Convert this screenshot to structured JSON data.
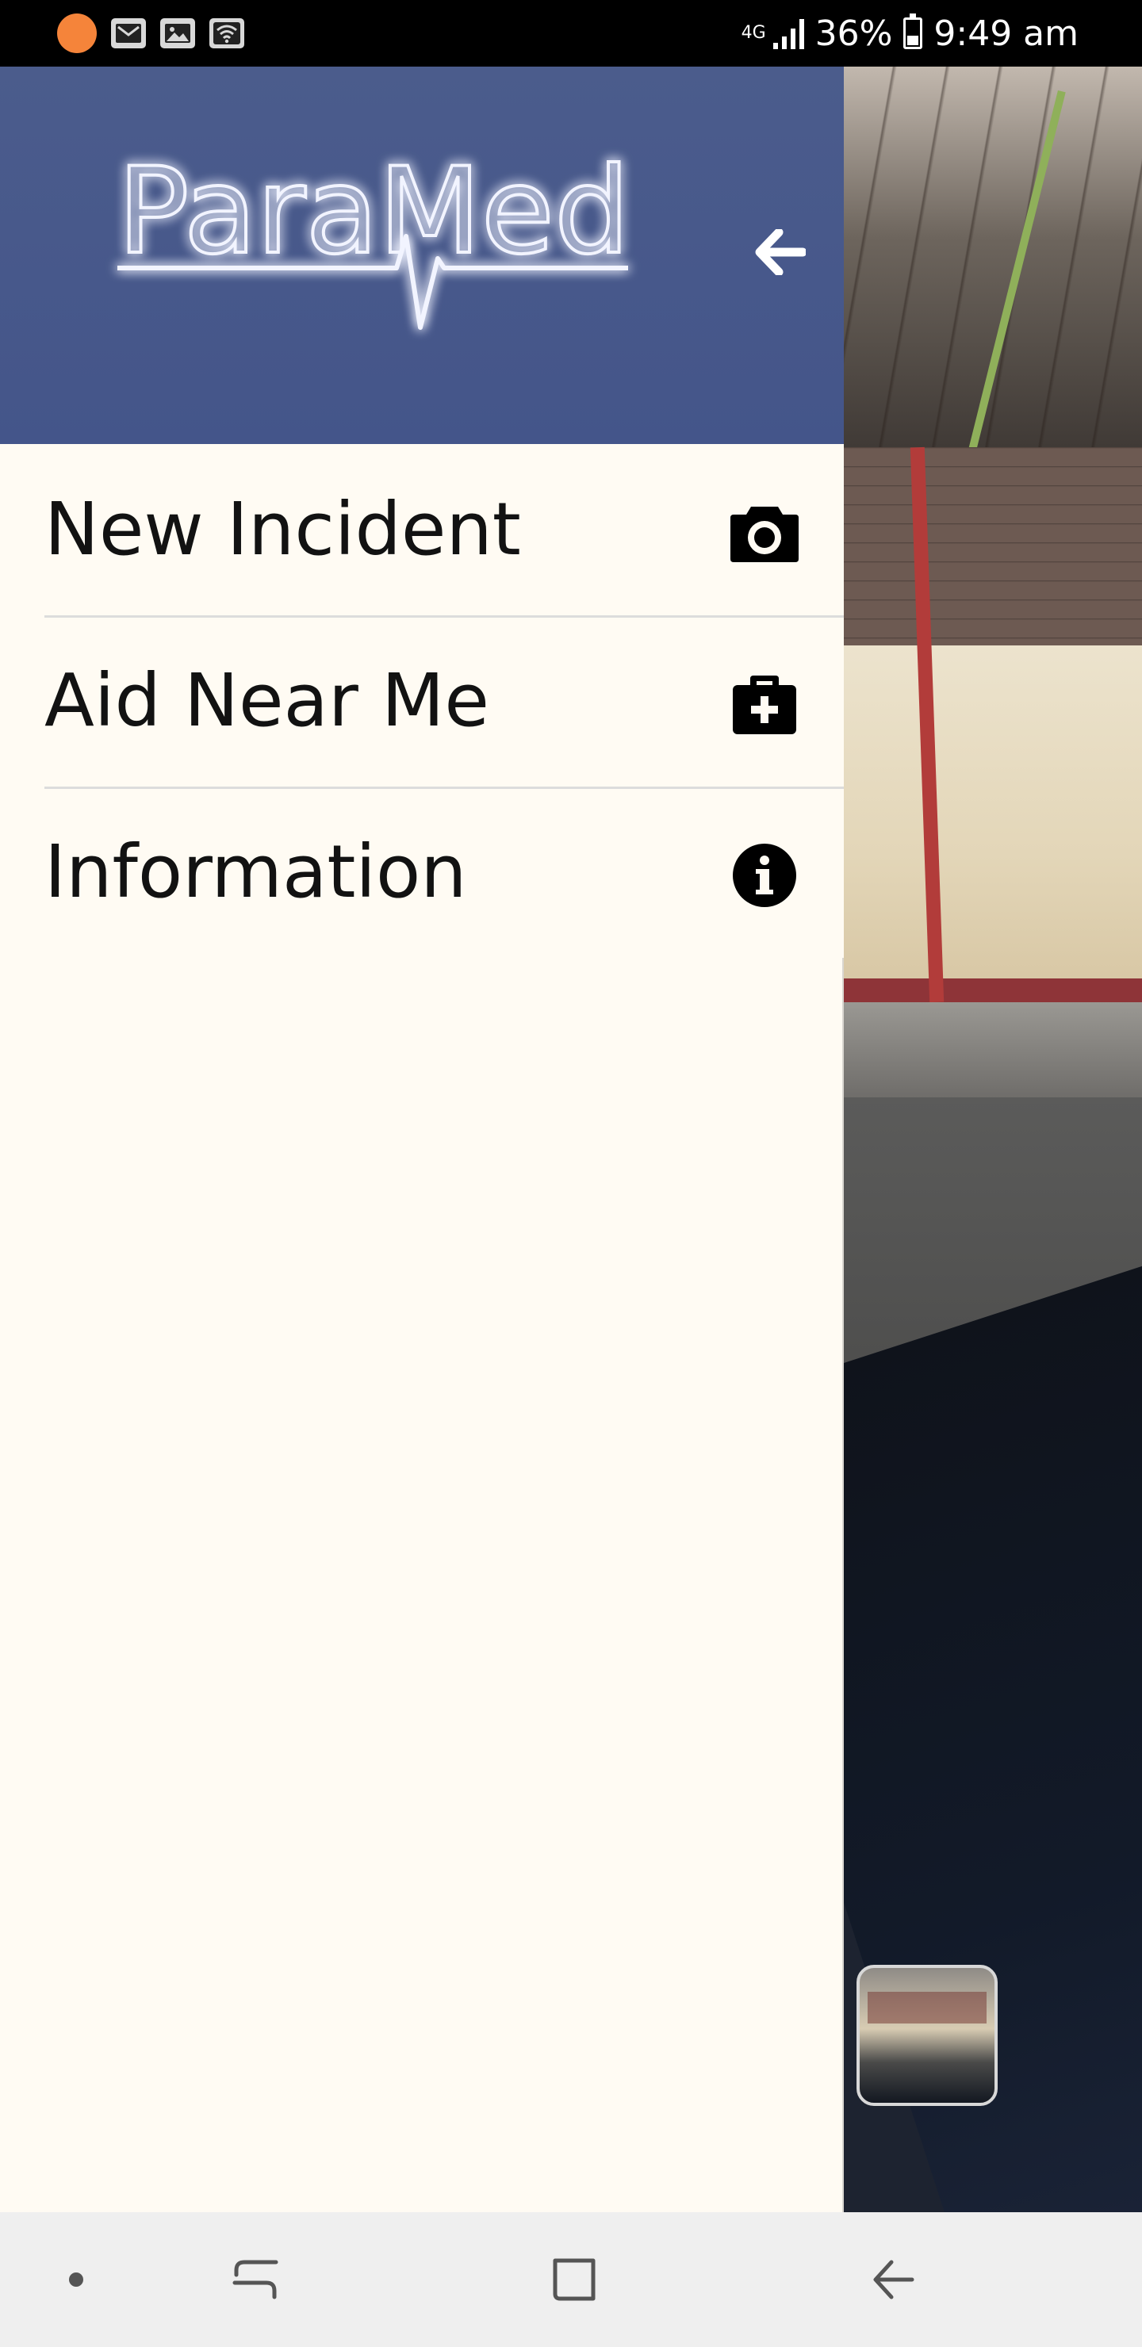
{
  "status_bar": {
    "network": "4G",
    "battery": "36%",
    "time": "9:49 am",
    "battery_level": 0.36,
    "icons": [
      "notification-dot-icon",
      "gmail-icon",
      "gallery-icon",
      "wifi-icon",
      "signal-icon",
      "battery-icon"
    ],
    "accent_notification": "#f5843a"
  },
  "drawer": {
    "logo_text": "ParaMed",
    "header_color": "#4b5c8c",
    "logo_glow_color": "#6a7dff",
    "back_icon": "arrow-back-icon",
    "items": [
      {
        "label": "New Incident",
        "icon": "camera-icon"
      },
      {
        "label": "Aid Near Me",
        "icon": "first-aid-kit-icon"
      },
      {
        "label": "Information",
        "icon": "info-icon"
      }
    ]
  },
  "background": {
    "gallery_thumbnail_icon": "gallery-thumbnail"
  },
  "nav_bar": {
    "buttons": [
      "home-dot-icon",
      "recent-apps-icon",
      "home-icon",
      "back-icon"
    ]
  }
}
